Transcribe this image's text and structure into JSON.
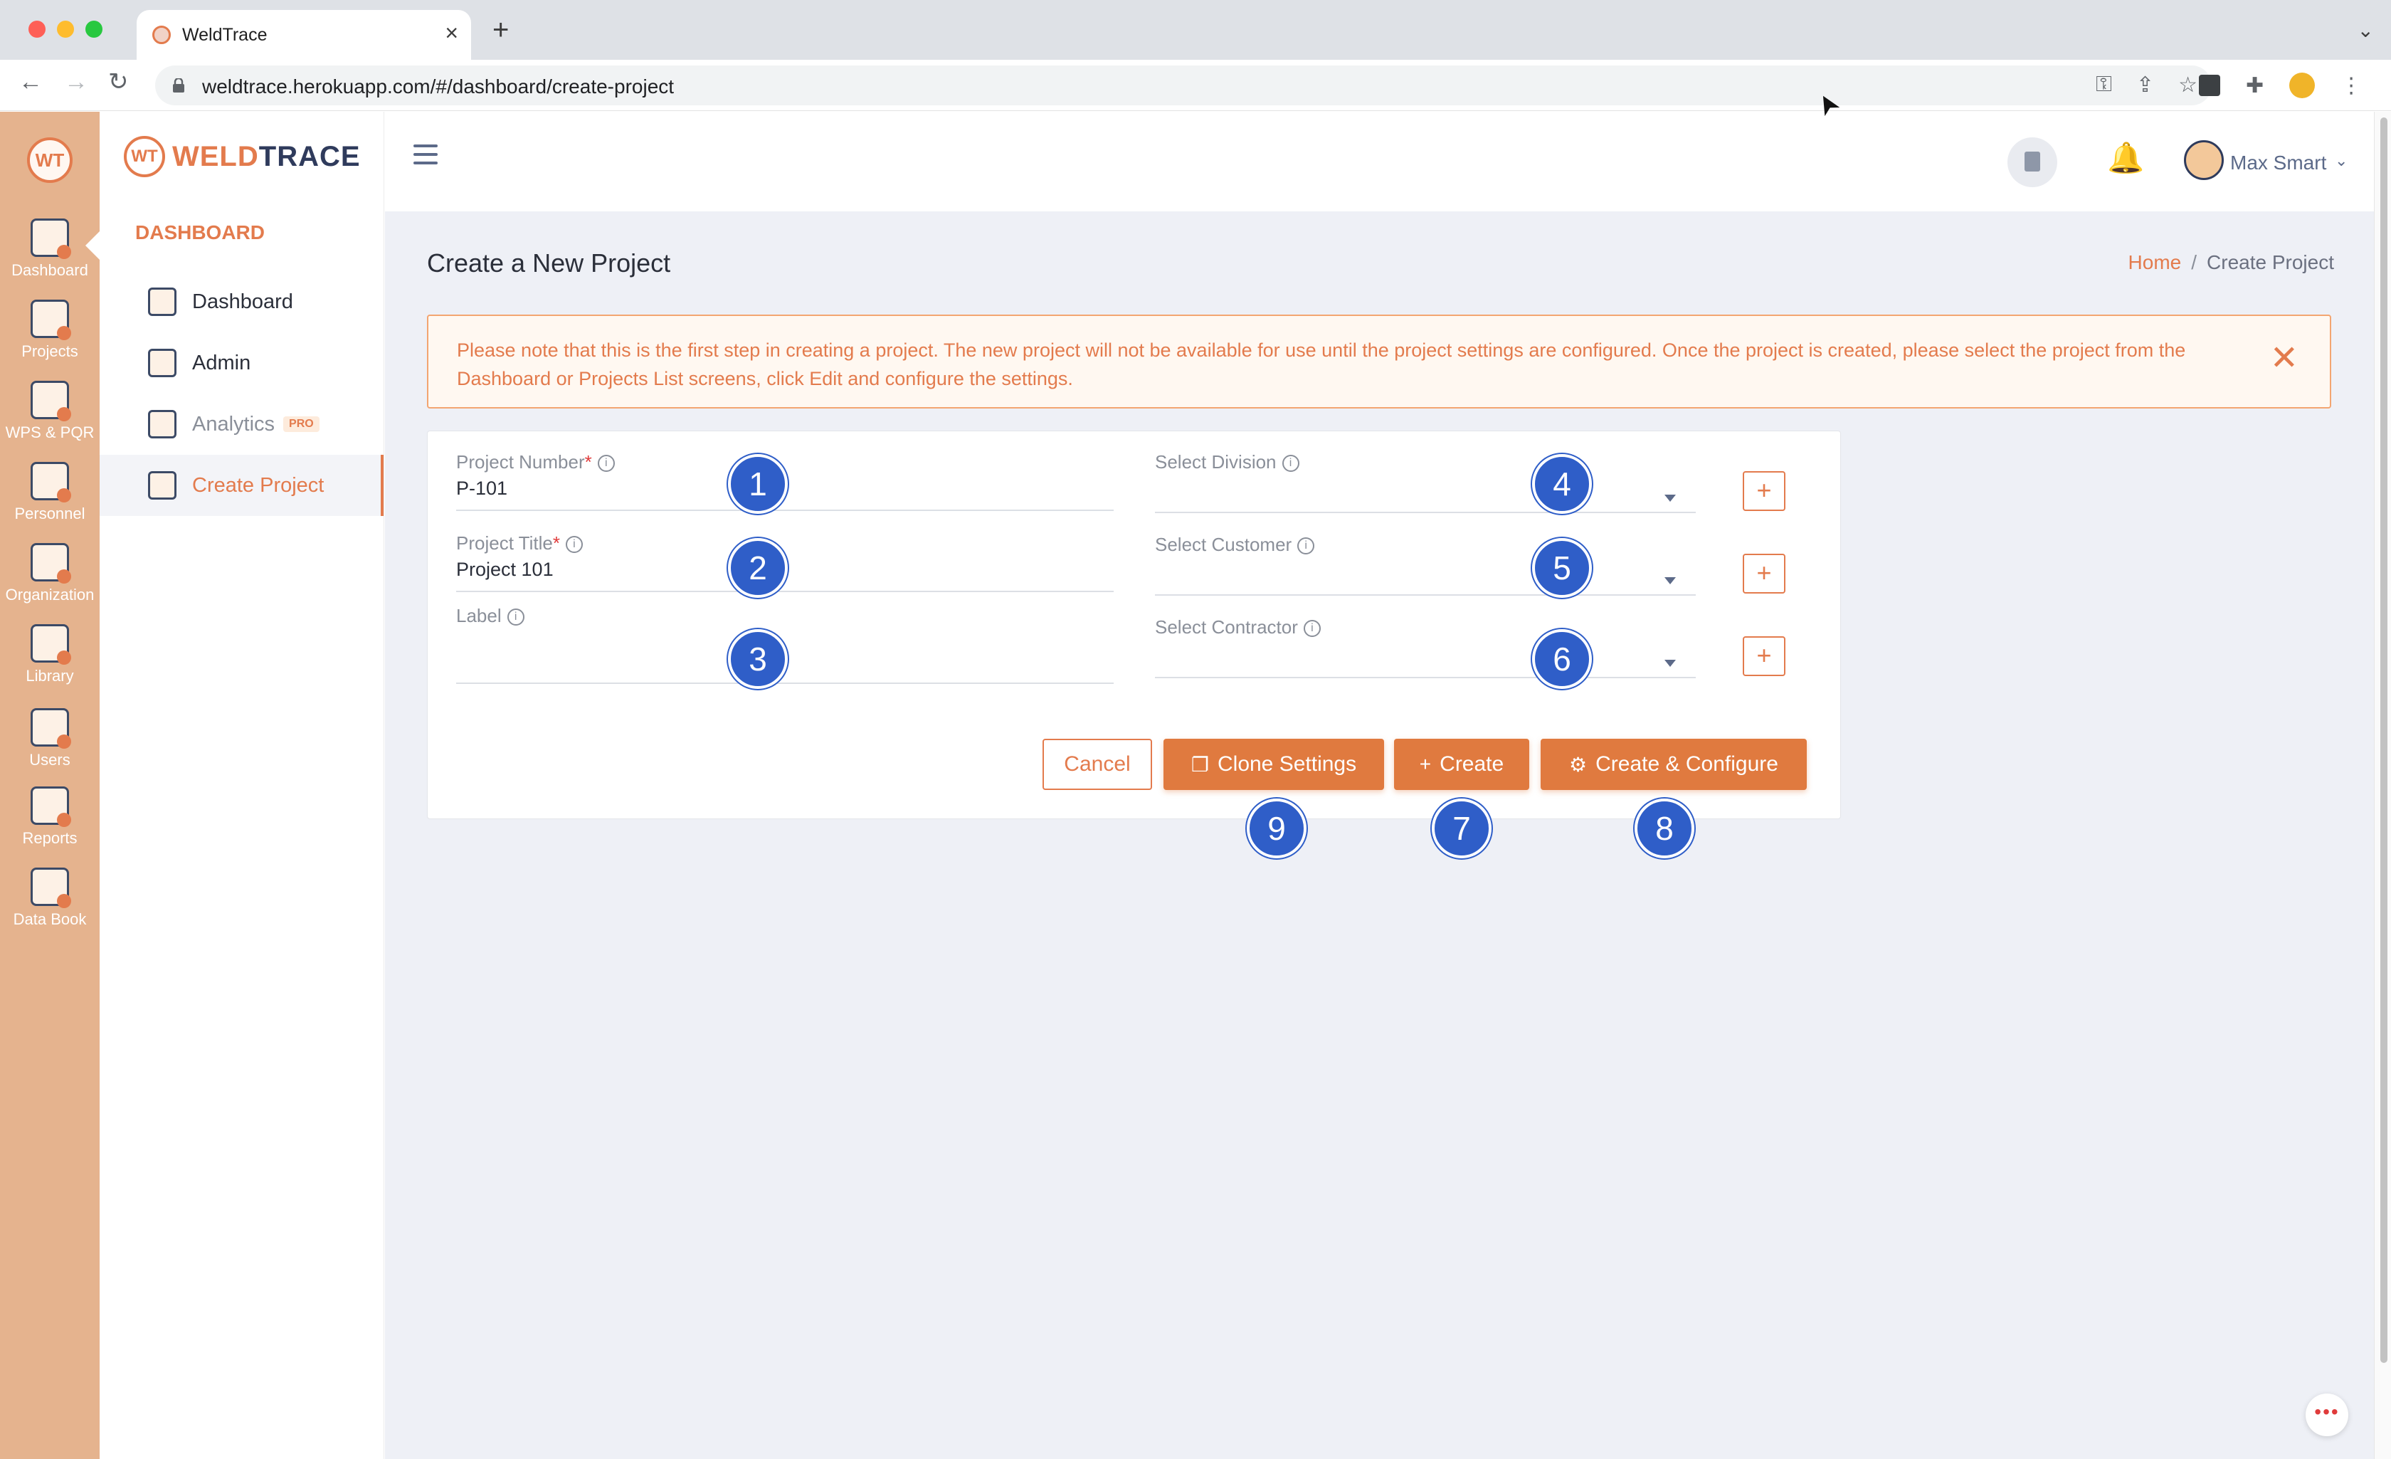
{
  "browser": {
    "tab_title": "WeldTrace",
    "tab_close": "×",
    "new_tab": "+",
    "tab_menu": "⌄",
    "url": "weldtrace.herokuapp.com/#/dashboard/create-project",
    "nav_back": "←",
    "nav_forward": "→",
    "nav_reload": "↻",
    "omni_icons": [
      "key-icon",
      "share-icon",
      "star-icon"
    ],
    "omni_glyphs": [
      "⚿",
      "⇪",
      "☆"
    ],
    "puzzle_glyph": "✚",
    "more_glyph": "⋮"
  },
  "rail": {
    "logo": "WT",
    "items": [
      {
        "label": "Dashboard",
        "icon": "dashboard-monitor-icon"
      },
      {
        "label": "Projects",
        "icon": "projects-folder-icon"
      },
      {
        "label": "WPS & PQR",
        "icon": "wps-pqr-icon"
      },
      {
        "label": "Personnel",
        "icon": "welder-icon"
      },
      {
        "label": "Organization",
        "icon": "organization-icon"
      },
      {
        "label": "Library",
        "icon": "library-icon"
      },
      {
        "label": "Users",
        "icon": "users-icon"
      },
      {
        "label": "Reports",
        "icon": "reports-icon"
      },
      {
        "label": "Data Book",
        "icon": "data-book-icon"
      }
    ]
  },
  "sidenav": {
    "brand_mark": "WT",
    "brand_weld": "WELD",
    "brand_trace": "TRACE",
    "section": "DASHBOARD",
    "items": [
      {
        "label": "Dashboard",
        "icon": "chart-icon"
      },
      {
        "label": "Admin",
        "icon": "gear-icon"
      },
      {
        "label": "Analytics",
        "badge": "PRO",
        "icon": "analytics-icon"
      },
      {
        "label": "Create Project",
        "icon": "folder-add-icon"
      }
    ]
  },
  "header": {
    "bell": "🔔",
    "username": "Max Smart",
    "chevron": "⌄"
  },
  "page": {
    "title": "Create a New Project",
    "breadcrumb_home": "Home",
    "breadcrumb_sep": "/",
    "breadcrumb_current": "Create Project"
  },
  "alert": {
    "text": "Please note that this is the first step in creating a project. The new project will not be available for use until the project settings are configured. Once the project is created, please select the project from the Dashboard or Projects List screens, click Edit and configure the settings.",
    "close": "✕"
  },
  "form": {
    "info_glyph": "i",
    "required_mark": "*",
    "project_number": {
      "label": "Project Number",
      "value": "P-101"
    },
    "project_title": {
      "label": "Project Title",
      "value": "Project 101"
    },
    "label": {
      "label": "Label",
      "value": ""
    },
    "division": {
      "label": "Select Division",
      "value": ""
    },
    "customer": {
      "label": "Select Customer",
      "value": ""
    },
    "contractor": {
      "label": "Select Contractor",
      "value": ""
    },
    "add_glyph": "+"
  },
  "buttons": {
    "cancel": "Cancel",
    "clone": "Clone Settings",
    "clone_icon": "❐",
    "create": "Create",
    "create_icon": "+",
    "create_configure": "Create & Configure",
    "create_configure_icon": "⚙"
  },
  "badges": [
    "1",
    "2",
    "3",
    "4",
    "5",
    "6",
    "7",
    "8",
    "9"
  ],
  "chat": "•••",
  "cursor": "➤"
}
